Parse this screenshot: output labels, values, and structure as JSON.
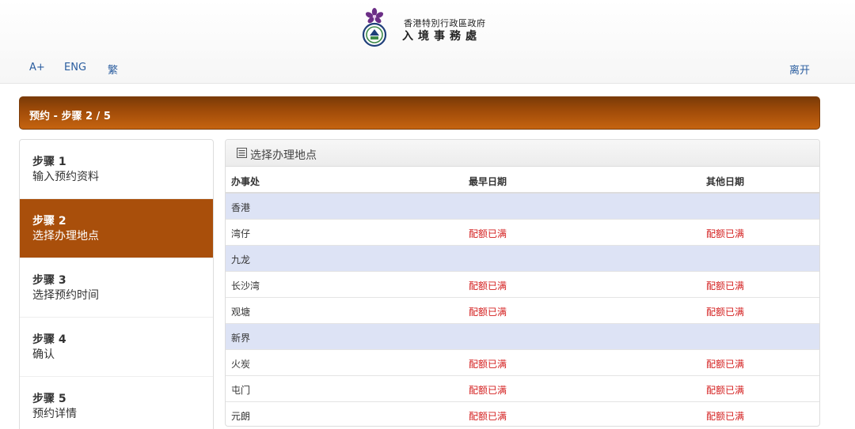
{
  "header": {
    "gov_name": "香港特別行政區政府",
    "dept_name": "入境事務處"
  },
  "toolbar": {
    "font_size": "A+",
    "english": "ENG",
    "traditional": "繁",
    "exit": "离开"
  },
  "banner": {
    "title": "预约 - 步骤 2 / 5"
  },
  "steps": [
    {
      "num": "步骤 1",
      "label": "输入预约资料"
    },
    {
      "num": "步骤 2",
      "label": "选择办理地点"
    },
    {
      "num": "步骤 3",
      "label": "选择预约时间"
    },
    {
      "num": "步骤 4",
      "label": "确认"
    },
    {
      "num": "步骤 5",
      "label": "预约详情"
    }
  ],
  "locations": {
    "title": "选择办理地点",
    "columns": [
      "办事处",
      "最早日期",
      "其他日期"
    ],
    "rows": [
      {
        "region": "香港"
      },
      {
        "office": "湾仔",
        "earliest": "配额已满",
        "other": "配额已满"
      },
      {
        "region": "九龙"
      },
      {
        "office": "长沙湾",
        "earliest": "配额已满",
        "other": "配额已满"
      },
      {
        "office": "观塘",
        "earliest": "配额已满",
        "other": "配额已满"
      },
      {
        "region": "新界"
      },
      {
        "office": "火炭",
        "earliest": "配额已满",
        "other": "配额已满"
      },
      {
        "office": "屯门",
        "earliest": "配额已满",
        "other": "配额已满"
      },
      {
        "office": "元朗",
        "earliest": "配额已满",
        "other": "配额已满"
      }
    ]
  },
  "colors": {
    "banner": "#a24c09",
    "active_step": "#a94f0b",
    "region_row": "#dde3f5",
    "quota_full": "#d42020",
    "link": "#2a5d9f"
  }
}
